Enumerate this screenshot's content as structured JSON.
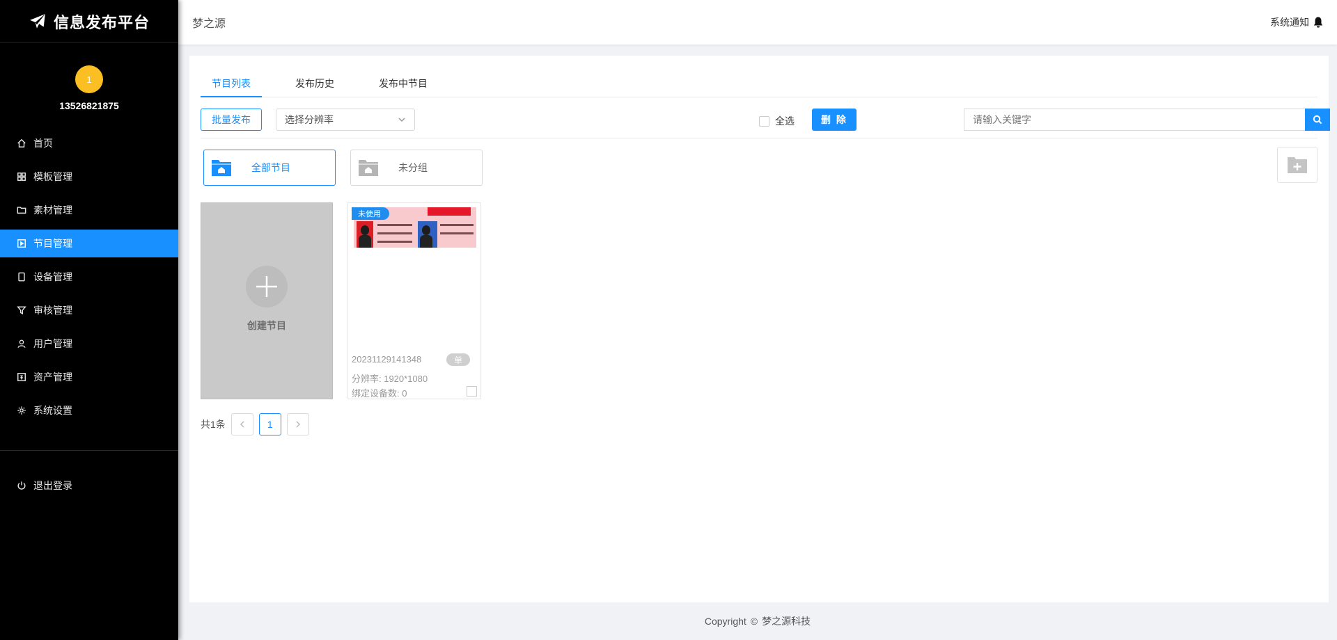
{
  "app": {
    "logo_text": "信息发布平台"
  },
  "profile": {
    "avatar_text": "1",
    "username": "13526821875"
  },
  "sidebar": {
    "items": [
      {
        "label": "首页",
        "icon": "home-icon"
      },
      {
        "label": "模板管理",
        "icon": "grid-icon"
      },
      {
        "label": "素材管理",
        "icon": "folder-icon"
      },
      {
        "label": "节目管理",
        "icon": "play-square-icon",
        "active": true
      },
      {
        "label": "设备管理",
        "icon": "tablet-icon"
      },
      {
        "label": "审核管理",
        "icon": "filter-icon"
      },
      {
        "label": "用户管理",
        "icon": "user-icon"
      },
      {
        "label": "资产管理",
        "icon": "account-book-icon"
      },
      {
        "label": "系统设置",
        "icon": "gear-icon"
      }
    ],
    "logout": "退出登录"
  },
  "header": {
    "title": "梦之源",
    "notify": "系统通知"
  },
  "tabs": [
    "节目列表",
    "发布历史",
    "发布中节目"
  ],
  "toolbar": {
    "batch_publish": "批量发布",
    "resolution_placeholder": "选择分辨率",
    "select_all": "全选",
    "delete": "删 除",
    "search_placeholder": "请输入关键字"
  },
  "folders": [
    {
      "label": "全部节目",
      "active": true
    },
    {
      "label": "未分组",
      "active": false
    }
  ],
  "create_card": {
    "label": "创建节目"
  },
  "programs": [
    {
      "status": "未使用",
      "name": "20231129141348",
      "tag": "单",
      "resolution": "分辨率: 1920*1080",
      "devices": "绑定设备数: 0"
    }
  ],
  "pagination": {
    "total": "共1条",
    "current": "1"
  },
  "footer": {
    "copyright": "Copyright",
    "company": "梦之源科技"
  },
  "colors": {
    "accent": "#1890ff",
    "sidebar_bg": "#000000",
    "avatar": "#fbbf24"
  }
}
